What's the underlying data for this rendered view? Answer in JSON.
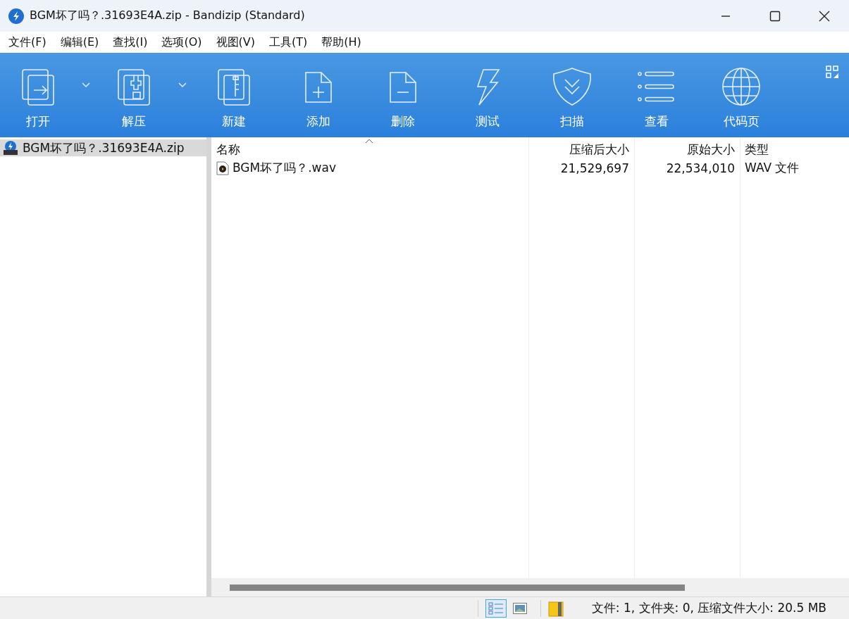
{
  "window": {
    "title": "BGM坏了吗？.31693E4A.zip - Bandizip (Standard)"
  },
  "menu": [
    "文件(F)",
    "编辑(E)",
    "查找(I)",
    "选项(O)",
    "视图(V)",
    "工具(T)",
    "帮助(H)"
  ],
  "toolbar": [
    {
      "label": "打开",
      "kind": "open",
      "dropdown": true
    },
    {
      "label": "解压",
      "kind": "extract",
      "dropdown": true
    },
    {
      "label": "新建",
      "kind": "new",
      "dropdown": false
    },
    {
      "label": "添加",
      "kind": "add",
      "dropdown": false
    },
    {
      "label": "删除",
      "kind": "delete",
      "dropdown": false
    },
    {
      "label": "测试",
      "kind": "test",
      "dropdown": false
    },
    {
      "label": "扫描",
      "kind": "scan",
      "dropdown": false
    },
    {
      "label": "查看",
      "kind": "view",
      "dropdown": false
    },
    {
      "label": "代码页",
      "kind": "codepage",
      "dropdown": false
    }
  ],
  "sidebar": {
    "items": [
      {
        "label": "BGM坏了吗？.31693E4A.zip",
        "selected": true
      }
    ]
  },
  "table": {
    "columns": [
      {
        "label": "名称",
        "sorted": true
      },
      {
        "label": "压缩后大小",
        "sorted": false
      },
      {
        "label": "原始大小",
        "sorted": false
      },
      {
        "label": "类型",
        "sorted": false
      }
    ],
    "rows": [
      {
        "cells": [
          "BGM坏了吗？.wav",
          "21,529,697",
          "22,534,010",
          "WAV 文件"
        ]
      }
    ]
  },
  "status_bar": {
    "view_buttons": [
      {
        "kind": "details",
        "selected": true
      },
      {
        "kind": "thumbnail",
        "selected": false
      }
    ],
    "text": "文件: 1, 文件夹: 0, 压缩文件大小: 20.5 MB"
  }
}
